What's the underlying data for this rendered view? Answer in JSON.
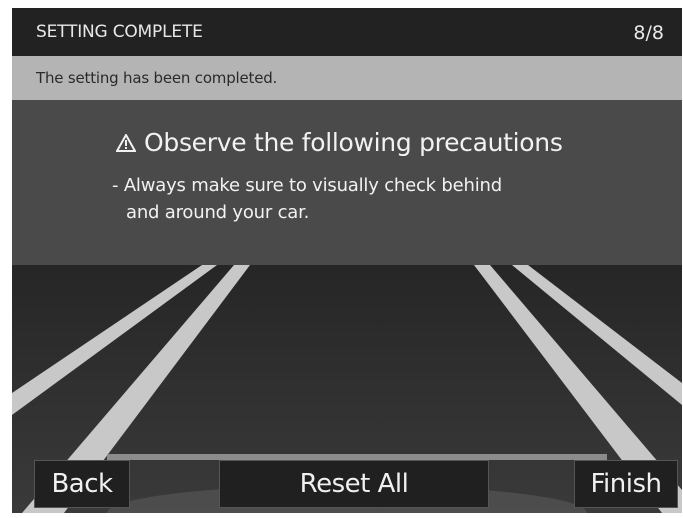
{
  "header": {
    "title": "SETTING COMPLETE",
    "page_counter": "8/8"
  },
  "status": {
    "message": "The setting has been completed."
  },
  "precaution": {
    "icon": "warning-triangle-icon",
    "heading": "Observe the following precautions",
    "body_line1": "- Always make sure to visually check behind",
    "body_line2": "and around your car."
  },
  "buttons": {
    "back": "Back",
    "reset_all": "Reset All",
    "finish": "Finish"
  },
  "colors": {
    "title_bar": "#222222",
    "status_bar": "#b4b4b4",
    "panel": "#4a4a4a",
    "road": "#2e2e2e",
    "lane_line": "#c8c8c8"
  }
}
